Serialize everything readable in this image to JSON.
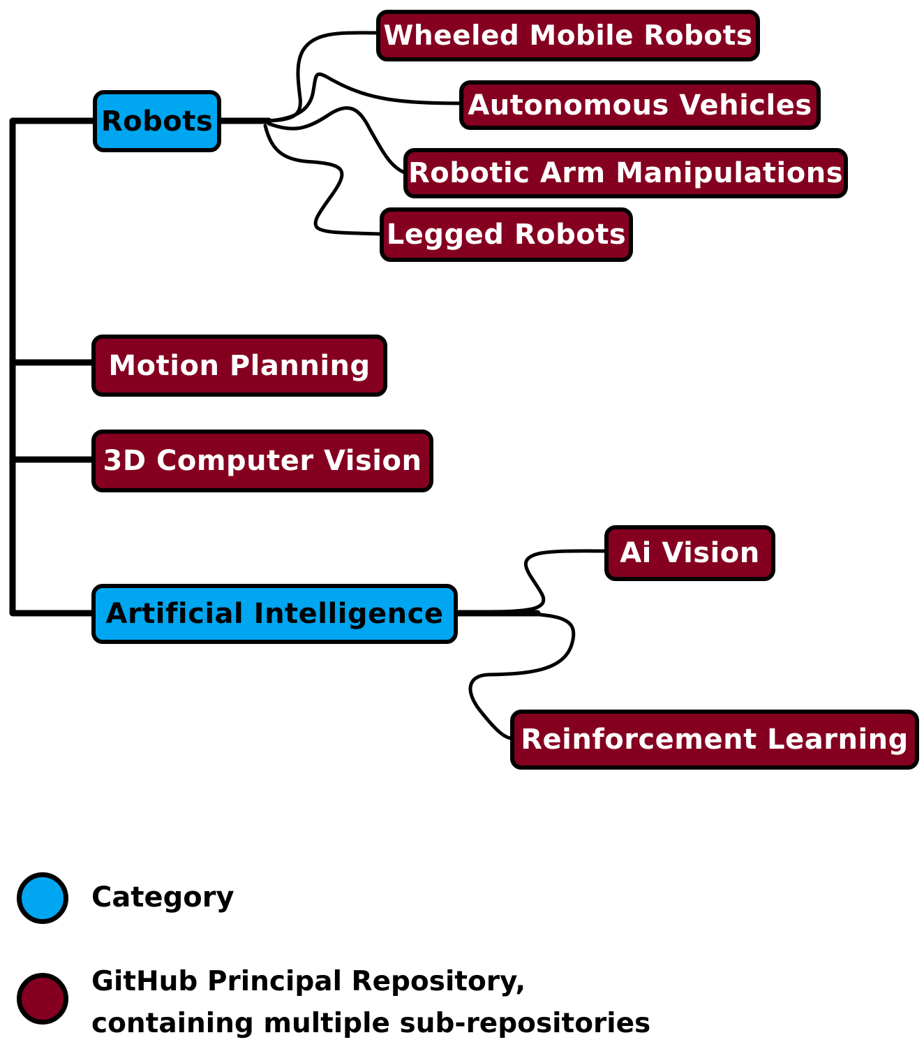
{
  "diagram": {
    "type": "mind-map",
    "colors": {
      "category": "#00a6ef",
      "repository": "#850020",
      "outline": "#000000",
      "repository_text": "#ffffff",
      "category_text": "#000000"
    },
    "root_children": [
      {
        "id": "robots",
        "label": "Robots",
        "kind": "category",
        "children": [
          {
            "id": "wheeled",
            "label": "Wheeled Mobile Robots",
            "kind": "repository"
          },
          {
            "id": "autonomous",
            "label": "Autonomous Vehicles",
            "kind": "repository"
          },
          {
            "id": "arm",
            "label": "Robotic Arm Manipulations",
            "kind": "repository"
          },
          {
            "id": "legged",
            "label": "Legged Robots",
            "kind": "repository"
          }
        ]
      },
      {
        "id": "motion",
        "label": "Motion Planning",
        "kind": "repository",
        "children": []
      },
      {
        "id": "vision3d",
        "label": "3D Computer Vision",
        "kind": "repository",
        "children": []
      },
      {
        "id": "ai",
        "label": "Artificial Intelligence",
        "kind": "category",
        "children": [
          {
            "id": "aivision",
            "label": "Ai Vision",
            "kind": "repository"
          },
          {
            "id": "rl",
            "label": "Reinforcement Learning",
            "kind": "repository"
          }
        ]
      }
    ]
  },
  "legend": {
    "items": [
      {
        "kind": "category",
        "label": "Category",
        "lines": [
          "Category"
        ]
      },
      {
        "kind": "repository",
        "label": "GitHub Principal Repository, containing multiple sub-repositories",
        "lines": [
          "GitHub Principal Repository,",
          "containing multiple sub-repositories"
        ]
      }
    ]
  }
}
